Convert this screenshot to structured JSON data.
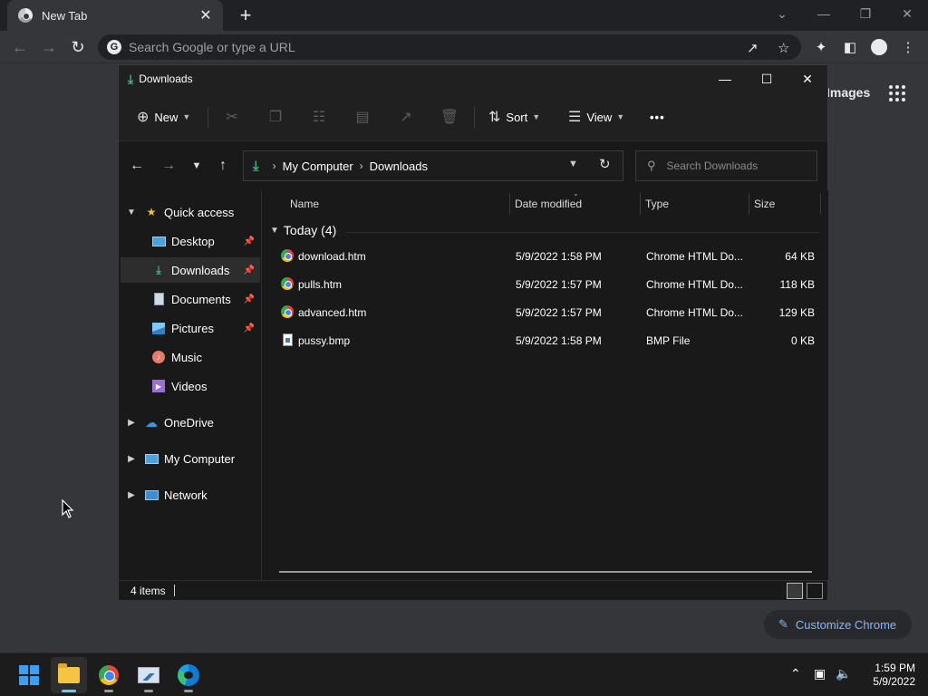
{
  "browser": {
    "tab_title": "New Tab",
    "tab_close": "✕",
    "new_tab": "+",
    "omnibox_placeholder": "Search Google or type a URL",
    "google_letter": "G",
    "images_link": "Images",
    "customize_label": "Customize Chrome"
  },
  "explorer": {
    "title": "Downloads",
    "commands": {
      "new": "New",
      "sort": "Sort",
      "view": "View",
      "more": "•••"
    },
    "breadcrumb": [
      "My Computer",
      "Downloads"
    ],
    "search_placeholder": "Search Downloads",
    "nav": {
      "quick_access": "Quick access",
      "items": [
        {
          "label": "Desktop",
          "pinned": true
        },
        {
          "label": "Downloads",
          "pinned": true,
          "selected": true
        },
        {
          "label": "Documents",
          "pinned": true
        },
        {
          "label": "Pictures",
          "pinned": true
        },
        {
          "label": "Music",
          "pinned": false
        },
        {
          "label": "Videos",
          "pinned": false
        }
      ],
      "onedrive": "OneDrive",
      "my_computer": "My Computer",
      "network": "Network"
    },
    "columns": {
      "name": "Name",
      "date": "Date modified",
      "type": "Type",
      "size": "Size"
    },
    "group_label": "Today (4)",
    "files": [
      {
        "name": "download.htm",
        "date": "5/9/2022 1:58 PM",
        "type": "Chrome HTML Do...",
        "size": "64 KB",
        "icon": "chrome-html-icon"
      },
      {
        "name": "pulls.htm",
        "date": "5/9/2022 1:57 PM",
        "type": "Chrome HTML Do...",
        "size": "118 KB",
        "icon": "chrome-html-icon"
      },
      {
        "name": "advanced.htm",
        "date": "5/9/2022 1:57 PM",
        "type": "Chrome HTML Do...",
        "size": "129 KB",
        "icon": "chrome-html-icon"
      },
      {
        "name": "pussy.bmp",
        "date": "5/9/2022 1:58 PM",
        "type": "BMP File",
        "size": "0 KB",
        "icon": "bmp-file-icon"
      }
    ],
    "status_count": "4 items"
  },
  "taskbar": {
    "time": "1:59 PM",
    "date": "5/9/2022"
  },
  "colors": {
    "accent_green": "#4caf7a",
    "link_blue": "#8ab4f8",
    "taskbar_active": "#60cdff"
  }
}
